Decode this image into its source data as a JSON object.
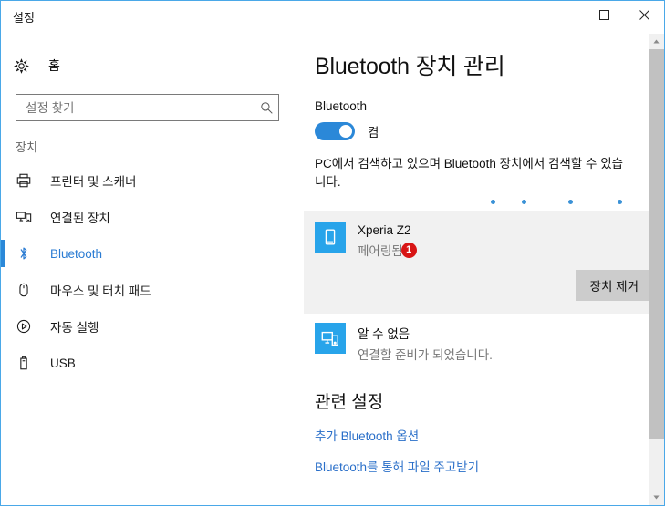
{
  "window": {
    "title": "설정",
    "controls": {
      "minimize": "—",
      "maximize": "☐",
      "close": "✕"
    }
  },
  "sidebar": {
    "home_label": "홈",
    "home_icon": "gear-icon",
    "search": {
      "placeholder": "설정 찾기",
      "value": "",
      "icon": "search-icon"
    },
    "group_title": "장치",
    "items": [
      {
        "label": "프린터 및 스캐너",
        "icon": "printer-icon",
        "selected": false
      },
      {
        "label": "연결된 장치",
        "icon": "connected-devices-icon",
        "selected": false
      },
      {
        "label": "Bluetooth",
        "icon": "bluetooth-icon",
        "selected": true
      },
      {
        "label": "마우스 및 터치 패드",
        "icon": "mouse-icon",
        "selected": false
      },
      {
        "label": "자동 실행",
        "icon": "autoplay-icon",
        "selected": false
      },
      {
        "label": "USB",
        "icon": "usb-icon",
        "selected": false
      }
    ]
  },
  "main": {
    "page_title": "Bluetooth 장치 관리",
    "bluetooth_label": "Bluetooth",
    "toggle": {
      "state_label": "켬",
      "on": true,
      "accent_color": "#2b88d8"
    },
    "description": "PC에서 검색하고 있으며 Bluetooth 장치에서 검색할 수 있습니다.",
    "progress_dots": {
      "count": 4,
      "color": "#3a91d6",
      "positions": [
        0,
        34,
        85,
        139
      ]
    },
    "devices": [
      {
        "name": "Xperia Z2",
        "status": "페어링됨",
        "badge": "1",
        "badge_color": "#d81515",
        "icon": "phone-icon",
        "icon_color": "#28a4ea",
        "selected": true,
        "action_button": "장치 제거"
      },
      {
        "name": "알 수 없음",
        "status": "연결할 준비가 되었습니다.",
        "badge": "",
        "icon": "connected-devices-icon",
        "icon_color": "#28a4ea",
        "selected": false,
        "action_button": ""
      }
    ],
    "related": {
      "title": "관련 설정",
      "links": [
        "추가 Bluetooth 옵션",
        "Bluetooth를 통해 파일 주고받기"
      ]
    }
  },
  "scrollbar": {
    "up_arrow": "▲",
    "down_arrow": "▼"
  }
}
